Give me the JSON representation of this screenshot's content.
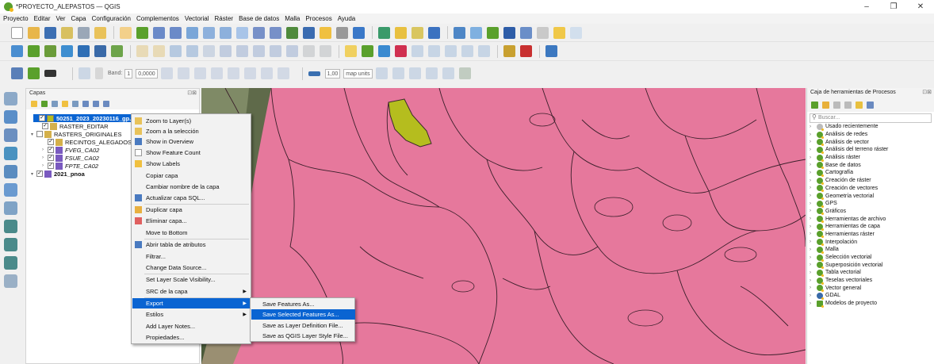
{
  "window": {
    "title": "*PROYECTO_ALEPASTOS — QGIS",
    "controls": {
      "minimize": "–",
      "maximize": "❐",
      "close": "✕"
    }
  },
  "menubar": [
    "Proyecto",
    "Editar",
    "Ver",
    "Capa",
    "Configuración",
    "Complementos",
    "Vectorial",
    "Ráster",
    "Base de datos",
    "Malla",
    "Procesos",
    "Ayuda"
  ],
  "label_toolbar": {
    "band_label": "Band:",
    "band_value": "1",
    "opacity_value": "0,0000",
    "size_value": "1,00",
    "unit_value": "map units"
  },
  "layers_panel": {
    "title": "Capas",
    "controls": "⊡⊠",
    "items": [
      {
        "label": "50251_2023_20230116_gp...",
        "checked": "✓",
        "expander": "",
        "selected": true
      },
      {
        "label": "RASTER_EDITAR",
        "checked": "✓",
        "expander": ""
      },
      {
        "label": "RASTERS_ORIGINALES",
        "checked": "",
        "expander": "▾"
      },
      {
        "label": "RECINTOS_ALEGADOS",
        "checked": "✓",
        "expander": ""
      },
      {
        "label": "FVEG_CA02",
        "checked": "✓",
        "expander": "›"
      },
      {
        "label": "FSUE_CA02",
        "checked": "✓",
        "expander": "›"
      },
      {
        "label": "FPTE_CA02",
        "checked": "✓",
        "expander": "›"
      },
      {
        "label": "2021_pnoa",
        "checked": "✓",
        "expander": "▾"
      }
    ]
  },
  "context_menu": {
    "items": [
      "Zoom to Layer(s)",
      "Zoom a la selección",
      "Show in Overview",
      "Show Feature Count",
      "Show Labels",
      "Copiar capa",
      "Cambiar nombre de la capa",
      "Actualizar capa SQL...",
      "Duplicar capa",
      "Eliminar capa...",
      "Move to Bottom",
      "Abrir tabla de atributos",
      "Filtrar...",
      "Change Data Source...",
      "Set Layer Scale Visibility...",
      "SRC de la capa",
      "Export",
      "Estilos",
      "Add Layer Notes...",
      "Propiedades..."
    ],
    "highlighted": "Export"
  },
  "export_submenu": {
    "items": [
      "Save Features As...",
      "Save Selected Features As...",
      "Save as Layer Definition File...",
      "Save as QGIS Layer Style File..."
    ],
    "highlighted": "Save Selected Features As..."
  },
  "processing_panel": {
    "title": "Caja de herramientas de Procesos",
    "controls": "⊡⊠",
    "search_placeholder": "Buscar...",
    "items": [
      "Usado recientemente",
      "Análisis de redes",
      "Análisis de vector",
      "Análisis del terreno ráster",
      "Análisis ráster",
      "Base de datos",
      "Cartografía",
      "Creación de ráster",
      "Creación de vectores",
      "Geometría vectorial",
      "GPS",
      "Gráficos",
      "Herramientas de archivo",
      "Herramientas de capa",
      "Herramientas ráster",
      "Interpolación",
      "Malla",
      "Selección vectorial",
      "Superposición vectorial",
      "Tabla vectorial",
      "Teselas vectoriales",
      "Vector general",
      "GDAL",
      "Modelos de proyecto"
    ]
  },
  "colors": {
    "map_fill": "#e6789c",
    "selected_parcel": "#b5bd1e",
    "selection_blue": "#0a64d2",
    "qgis_green": "#5aa02c",
    "qgis_yellow": "#f3b81b"
  }
}
